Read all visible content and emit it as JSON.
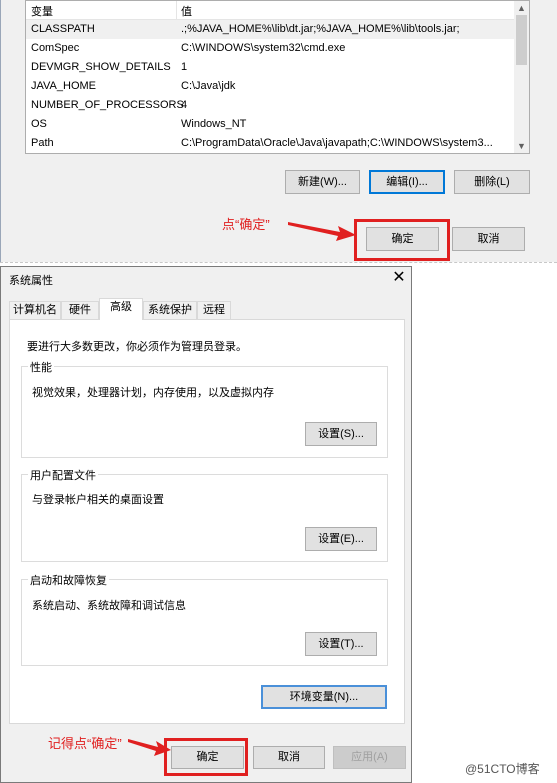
{
  "env_vars": {
    "col_variable": "变量",
    "col_value": "值",
    "rows": [
      {
        "name": "CLASSPATH",
        "value": ".;%JAVA_HOME%\\lib\\dt.jar;%JAVA_HOME%\\lib\\tools.jar;"
      },
      {
        "name": "ComSpec",
        "value": "C:\\WINDOWS\\system32\\cmd.exe"
      },
      {
        "name": "DEVMGR_SHOW_DETAILS",
        "value": "1"
      },
      {
        "name": "JAVA_HOME",
        "value": "C:\\Java\\jdk"
      },
      {
        "name": "NUMBER_OF_PROCESSORS",
        "value": "4"
      },
      {
        "name": "OS",
        "value": "Windows_NT"
      },
      {
        "name": "Path",
        "value": "C:\\ProgramData\\Oracle\\Java\\javapath;C:\\WINDOWS\\system3..."
      }
    ],
    "buttons": {
      "new": "新建(W)...",
      "edit": "编辑(I)...",
      "delete": "删除(L)"
    },
    "ok": "确定",
    "cancel": "取消",
    "annotation": "点“确定”"
  },
  "dialog": {
    "title": "系统属性",
    "close": "✕",
    "tabs": [
      "计算机名",
      "硬件",
      "高级",
      "系统保护",
      "远程"
    ],
    "admin_note": "要进行大多数更改，你必须作为管理员登录。",
    "performance": {
      "title": "性能",
      "desc": "视觉效果，处理器计划，内存使用，以及虚拟内存",
      "button": "设置(S)..."
    },
    "profile": {
      "title": "用户配置文件",
      "desc": "与登录帐户相关的桌面设置",
      "button": "设置(E)..."
    },
    "startup": {
      "title": "启动和故障恢复",
      "desc": "系统启动、系统故障和调试信息",
      "button": "设置(T)..."
    },
    "env_button": "环境变量(N)...",
    "ok": "确定",
    "cancel": "取消",
    "apply": "应用(A)",
    "annotation": "记得点“确定”"
  },
  "watermark": "@51CTO博客",
  "colors": {
    "annotation_red": "#e02020",
    "focus_blue": "#0078d7"
  }
}
